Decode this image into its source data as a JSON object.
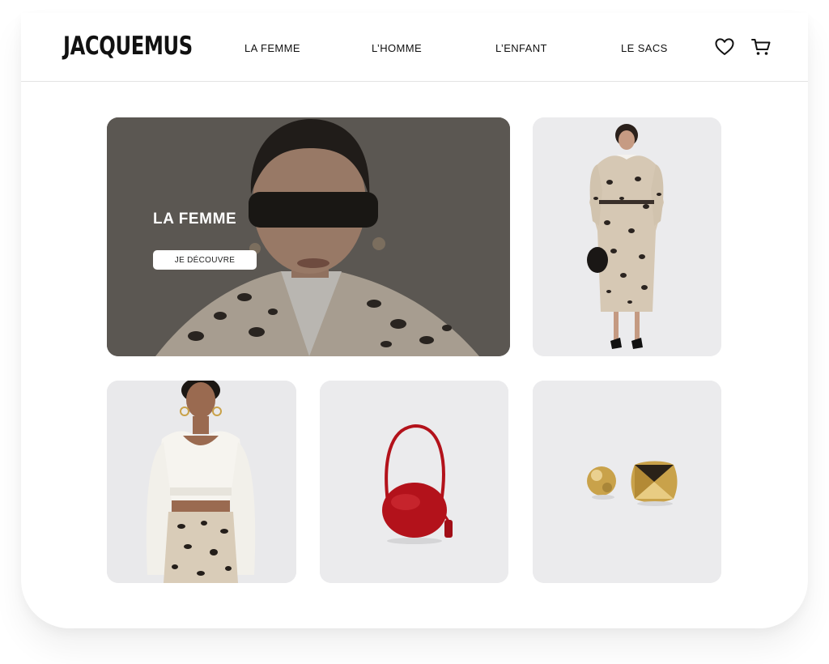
{
  "brand": {
    "logo": "JACQUEMUS"
  },
  "nav": {
    "items": [
      {
        "label": "LA FEMME"
      },
      {
        "label": "L’HOMME"
      },
      {
        "label": "L’ENFANT"
      },
      {
        "label": "LE SACS"
      }
    ]
  },
  "header_icons": [
    "heart-icon",
    "cart-icon"
  ],
  "hero": {
    "title": "LA FEMME",
    "button_label": "JE DÉCOUVRE"
  },
  "products": [
    {
      "name": "leopard-print-coat-look",
      "image": "product-photo"
    },
    {
      "name": "white-cropped-shirt-and-print-skirt",
      "image": "product-photo"
    },
    {
      "name": "red-round-bag",
      "image": "product-photo"
    },
    {
      "name": "gold-earrings",
      "image": "product-photo"
    }
  ],
  "colors": {
    "text": "#111111",
    "card_bg": "#ebebed",
    "bag_red": "#b3121b",
    "gold": "#c9a24a"
  }
}
